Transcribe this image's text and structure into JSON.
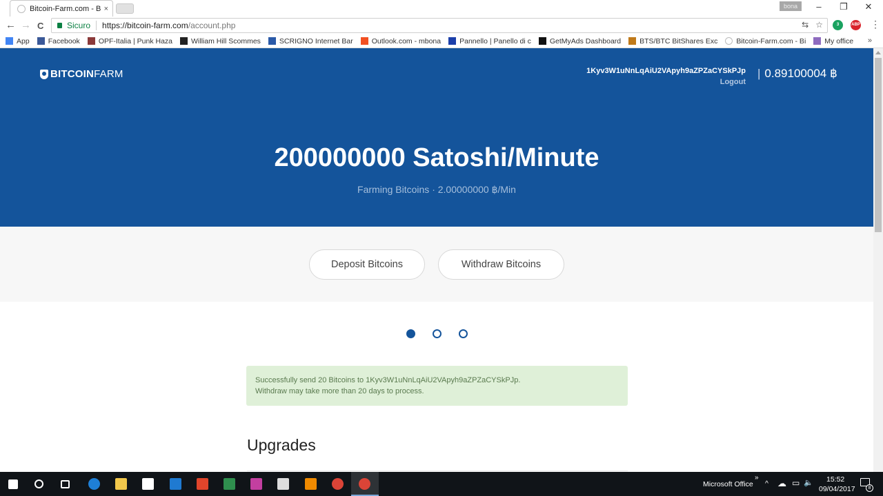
{
  "browser": {
    "tab_title": "Bitcoin-Farm.com - Bitco",
    "tab_close": "×",
    "user_badge": "bona",
    "window_controls": {
      "minimize": "–",
      "restore": "❐",
      "close": "✕"
    },
    "nav": {
      "back": "←",
      "forward": "→",
      "reload": "C"
    },
    "security_label": "Sicuro",
    "url_host": "https://bitcoin-farm.com",
    "url_path": "/account.php",
    "omnibox_icons": {
      "translate": "⇆",
      "star": "☆"
    },
    "extensions": [
      {
        "name": "eye-extension",
        "badge": "3",
        "color": "#1aa260"
      },
      {
        "name": "adblock-extension",
        "label": "ABP",
        "color": "#d9242c"
      }
    ],
    "menu": "⋮",
    "bookmarks": [
      {
        "label": "App",
        "icon": "apps-grid-icon",
        "color": "#4285f4"
      },
      {
        "label": "Facebook",
        "icon": "facebook-icon",
        "color": "#3b5998"
      },
      {
        "label": "OPF-Italia | Punk Haza",
        "icon": "opf-icon",
        "color": "#8b3a3a"
      },
      {
        "label": "William Hill Scommes",
        "icon": "william-hill-icon",
        "color": "#222222"
      },
      {
        "label": "SCRIGNO Internet Bar",
        "icon": "scrigno-icon",
        "color": "#2b5aa8"
      },
      {
        "label": "Outlook.com - mbona",
        "icon": "microsoft-icon",
        "color": "#f25022"
      },
      {
        "label": "Pannello | Panello di c",
        "icon": "pannello-icon",
        "color": "#1c3faa"
      },
      {
        "label": "GetMyAds Dashboard",
        "icon": "getmyads-icon",
        "color": "#111111"
      },
      {
        "label": "BTS/BTC BitShares Exc",
        "icon": "bitshares-icon",
        "color": "#c07a1a"
      },
      {
        "label": "Bitcoin-Farm.com - Bi",
        "icon": "bitcoin-farm-icon",
        "color": "#bbbbbb"
      },
      {
        "label": "My office",
        "icon": "gem-icon",
        "color": "#8e6bbf"
      }
    ],
    "bookmarks_more": "»"
  },
  "site": {
    "logo_bold": "BITCOIN",
    "logo_light": "FARM",
    "wallet_address": "1Kyv3W1uNnLqAiU2VApyh9aZPZaCYSkPJp",
    "logout_label": "Logout",
    "balance_separator": "|",
    "balance": "0.89100004 ฿",
    "rate_headline": "200000000 Satoshi/Minute",
    "rate_sub": "Farming Bitcoins · 2.00000000 ฿/Min",
    "deposit_label": "Deposit Bitcoins",
    "withdraw_label": "Withdraw Bitcoins",
    "carousel": {
      "count": 3,
      "active_index": 0
    },
    "alert_line1": "Successfully send 20 Bitcoins to 1Kyv3W1uNnLqAiU2VApyh9aZPZaCYSkPJp.",
    "alert_line2": "Withdraw may take more than 20 days to process.",
    "section_title": "Upgrades",
    "colors": {
      "brand": "#14549b",
      "alert_bg": "#dff0d8"
    }
  },
  "taskbar": {
    "apps": [
      {
        "name": "start-icon"
      },
      {
        "name": "search-icon"
      },
      {
        "name": "task-view-icon"
      },
      {
        "name": "edge-icon",
        "color": "#1e7fd6"
      },
      {
        "name": "file-explorer-icon",
        "color": "#f2c84b"
      },
      {
        "name": "store-icon",
        "color": "#ffffff"
      },
      {
        "name": "sky-icon",
        "color": "#1f7ad1"
      },
      {
        "name": "health-app-icon",
        "color": "#e0452b"
      },
      {
        "name": "excel-icon",
        "color": "#2f8f4e"
      },
      {
        "name": "media-app-icon",
        "color": "#c33fa0"
      },
      {
        "name": "calculator-icon",
        "color": "#dddddd"
      },
      {
        "name": "vlc-icon",
        "color": "#f08a00"
      },
      {
        "name": "chrome-icon",
        "color": "#db4437"
      },
      {
        "name": "chrome-active-icon",
        "color": "#db4437"
      }
    ],
    "tray_label": "Microsoft Office",
    "tray_more": "»",
    "tray_icons": {
      "chevron": "^",
      "cloud": "☁",
      "battery": "▭",
      "volume": "🔈"
    },
    "time": "15:52",
    "date": "09/04/2017",
    "notifications": "8"
  }
}
